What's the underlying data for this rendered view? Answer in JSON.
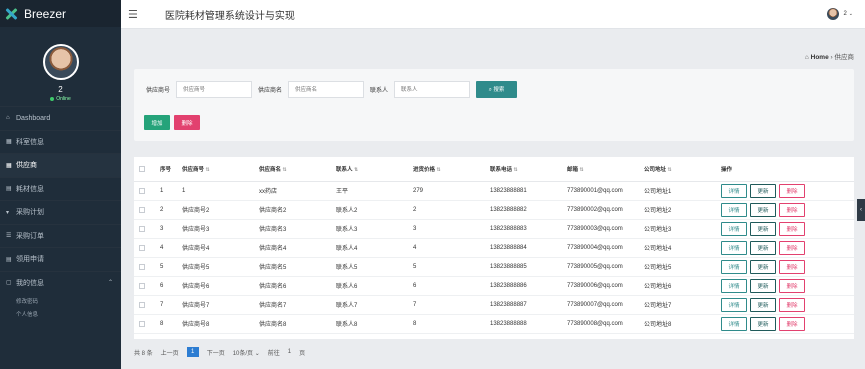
{
  "brand": {
    "name": "Breezer"
  },
  "profile": {
    "name": "2",
    "status": "Online"
  },
  "sidebar": {
    "items": [
      {
        "icon": "⌂",
        "label": "Dashboard",
        "active": false
      },
      {
        "icon": "▦",
        "label": "科室信息",
        "active": false
      },
      {
        "icon": "▦",
        "label": "供应商",
        "active": true
      },
      {
        "icon": "▤",
        "label": "耗材信息",
        "active": false
      },
      {
        "icon": "▾",
        "label": "采购计划",
        "active": false
      },
      {
        "icon": "☰",
        "label": "采购订单",
        "active": false
      },
      {
        "icon": "▤",
        "label": "领用申请",
        "active": false
      },
      {
        "icon": "▢",
        "label": "我的信息",
        "active": false,
        "expanded": true
      }
    ],
    "subitems": [
      "修改密码",
      "个人信息"
    ]
  },
  "topbar": {
    "title": "医院耗材管理系统设计与实现",
    "user": "2"
  },
  "breadcrumb": {
    "home": "Home",
    "current": "供应商"
  },
  "search": {
    "fields": [
      {
        "label": "供应商号",
        "placeholder": "供应商号"
      },
      {
        "label": "供应商名",
        "placeholder": "供应商名"
      },
      {
        "label": "联系人",
        "placeholder": "联系人"
      }
    ],
    "search_label": "搜索",
    "add_label": "增加",
    "delete_label": "删除"
  },
  "table": {
    "headers": [
      "序号",
      "供应商号",
      "供应商名",
      "联系人",
      "进货价格",
      "联系电话",
      "邮箱",
      "公司地址",
      "操作"
    ],
    "rows": [
      [
        "1",
        "1",
        "xx药店",
        "王平",
        "279",
        "13823888881",
        "773890001@qq.com",
        "公司地址1"
      ],
      [
        "2",
        "供应商号2",
        "供应商名2",
        "联系人2",
        "2",
        "13823888882",
        "773890002@qq.com",
        "公司地址2"
      ],
      [
        "3",
        "供应商号3",
        "供应商名3",
        "联系人3",
        "3",
        "13823888883",
        "773890003@qq.com",
        "公司地址3"
      ],
      [
        "4",
        "供应商号4",
        "供应商名4",
        "联系人4",
        "4",
        "13823888884",
        "773890004@qq.com",
        "公司地址4"
      ],
      [
        "5",
        "供应商号5",
        "供应商名5",
        "联系人5",
        "5",
        "13823888885",
        "773890005@qq.com",
        "公司地址5"
      ],
      [
        "6",
        "供应商号6",
        "供应商名6",
        "联系人6",
        "6",
        "13823888886",
        "773890006@qq.com",
        "公司地址6"
      ],
      [
        "7",
        "供应商号7",
        "供应商名7",
        "联系人7",
        "7",
        "13823888887",
        "773890007@qq.com",
        "公司地址7"
      ],
      [
        "8",
        "供应商号8",
        "供应商名8",
        "联系人8",
        "8",
        "13823888888",
        "773890008@qq.com",
        "公司地址8"
      ]
    ],
    "actions": {
      "detail": "详情",
      "update": "更新",
      "delete": "删除"
    }
  },
  "pager": {
    "total": "共 8 条",
    "prev": "上一页",
    "page": "1",
    "next": "下一页",
    "size": "10条/页",
    "goto": "前往",
    "goto_value": "1",
    "page_unit": "页"
  }
}
